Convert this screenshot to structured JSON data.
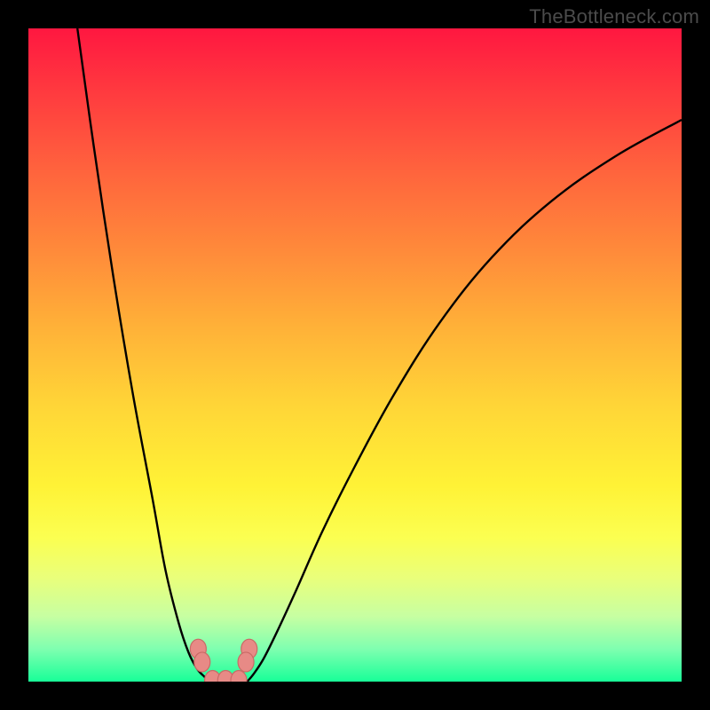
{
  "watermark": "TheBottleneck.com",
  "colors": {
    "frame": "#000000",
    "curve": "#000000",
    "marker_fill": "#e78a86",
    "marker_stroke": "#c96a66",
    "gradient_top": "#ff1740",
    "gradient_bottom": "#18ff98"
  },
  "chart_data": {
    "type": "line",
    "title": "",
    "xlabel": "",
    "ylabel": "",
    "xlim": [
      0,
      100
    ],
    "ylim": [
      0,
      100
    ],
    "grid": false,
    "legend": false,
    "annotations": [
      "TheBottleneck.com"
    ],
    "series": [
      {
        "name": "left-branch",
        "x": [
          7.5,
          10,
          13,
          16,
          19,
          21,
          23,
          24.5,
          25.8,
          27,
          27.8
        ],
        "y": [
          100,
          82,
          62,
          44,
          28,
          17,
          9,
          4.5,
          2,
          0.7,
          0
        ]
      },
      {
        "name": "right-branch",
        "x": [
          33.5,
          34.5,
          36,
          38,
          41,
          45,
          50,
          56,
          63,
          71,
          80,
          90,
          100
        ],
        "y": [
          0,
          1.2,
          3.5,
          7.5,
          14,
          23,
          33,
          44,
          55,
          65,
          73.5,
          80.5,
          86
        ]
      }
    ],
    "markers": [
      {
        "name": "left-cluster-top",
        "x": 26.0,
        "y": 5.0
      },
      {
        "name": "left-cluster-mid",
        "x": 26.6,
        "y": 3.0
      },
      {
        "name": "right-cluster-top",
        "x": 33.8,
        "y": 5.0
      },
      {
        "name": "right-cluster-mid",
        "x": 33.3,
        "y": 3.0
      },
      {
        "name": "bottom-left",
        "x": 28.2,
        "y": 0.2
      },
      {
        "name": "bottom-mid",
        "x": 30.2,
        "y": 0.2
      },
      {
        "name": "bottom-right",
        "x": 32.2,
        "y": 0.2
      }
    ]
  }
}
